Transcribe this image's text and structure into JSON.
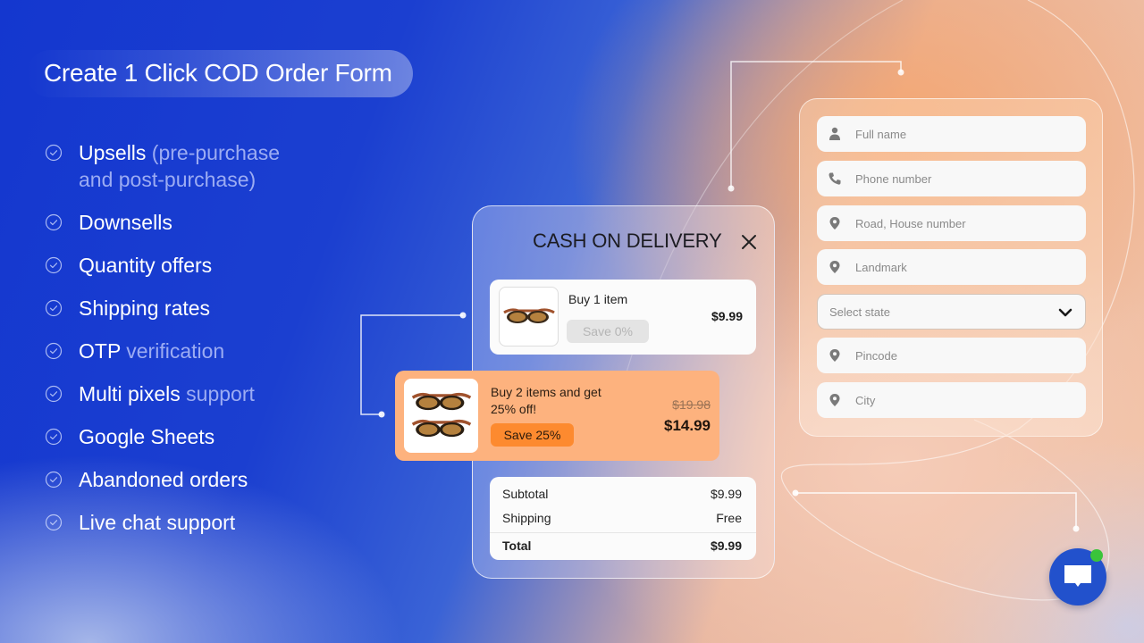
{
  "hero": {
    "title": "Create 1 Click COD Order Form"
  },
  "features": [
    {
      "main": "Upsells",
      "dim": " (pre-purchase",
      "line2": "and post-purchase)"
    },
    {
      "main": "Downsells",
      "dim": ""
    },
    {
      "main": "Quantity offers",
      "dim": ""
    },
    {
      "main": "Shipping rates",
      "dim": ""
    },
    {
      "main": "OTP",
      "dim": " verification"
    },
    {
      "main": "Multi pixels",
      "dim": " support"
    },
    {
      "main": "Google Sheets",
      "dim": ""
    },
    {
      "main": "Abandoned orders",
      "dim": ""
    },
    {
      "main": "Live chat support",
      "dim": ""
    }
  ],
  "cod": {
    "title": "CASH ON DELIVERY",
    "close_icon": "close-icon",
    "offers": [
      {
        "label": "Buy 1 item",
        "badge": "Save 0%",
        "price": "$9.99",
        "selected": false
      },
      {
        "label": "Buy 2 items and get 25% off!",
        "badge": "Save 25%",
        "old_price": "$19.98",
        "price": "$14.99",
        "selected": true
      }
    ],
    "summary": {
      "subtotal_label": "Subtotal",
      "subtotal_value": "$9.99",
      "shipping_label": "Shipping",
      "shipping_value": "Free",
      "total_label": "Total",
      "total_value": "$9.99"
    }
  },
  "form": {
    "fields": [
      {
        "icon": "user-icon",
        "placeholder": "Full name"
      },
      {
        "icon": "phone-icon",
        "placeholder": "Phone number"
      },
      {
        "icon": "location-pin-icon",
        "placeholder": "Road, House number"
      },
      {
        "icon": "location-pin-icon",
        "placeholder": "Landmark"
      },
      {
        "icon": "chevron-down-icon",
        "placeholder": "Select state",
        "type": "select"
      },
      {
        "icon": "location-pin-icon",
        "placeholder": "Pincode"
      },
      {
        "icon": "location-pin-icon",
        "placeholder": "City"
      }
    ]
  },
  "chat": {
    "icon": "chat-bubble-icon",
    "status": "online"
  },
  "colors": {
    "bg_blue": "#1437cf",
    "bg_orange": "#f5a56e",
    "offer_selected_bg": "#fdb27e",
    "offer_badge": "#fd8a2f",
    "chat_button": "#2251cc",
    "online_dot": "#3ac43a"
  }
}
